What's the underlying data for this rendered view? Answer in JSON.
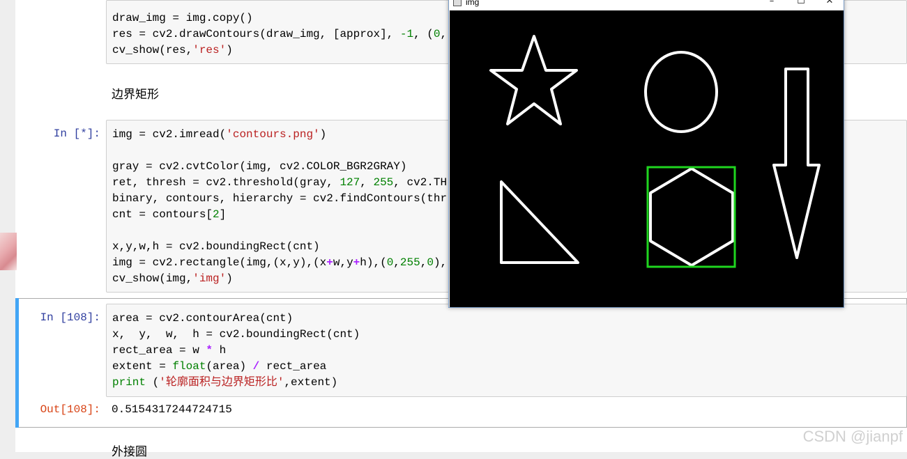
{
  "cells": {
    "top_code": {
      "lines": [
        "draw_img = img.copy()",
        "res = cv2.drawContours(draw_img, [approx], -1, (0,",
        "cv_show(res,'res')"
      ]
    },
    "markdown_heading": "边界矩形",
    "cell_bounding": {
      "prompt": "In [*]:",
      "line1": "img = cv2.imread(",
      "line1_str": "'contours.png'",
      "line1_end": ")",
      "line3": "gray = cv2.cvtColor(img, cv2.COLOR_BGR2GRAY)",
      "line4_a": "ret, thresh = cv2.threshold(gray, ",
      "line4_n1": "127",
      "line4_b": ", ",
      "line4_n2": "255",
      "line4_c": ", cv2.TH",
      "line5": "binary, contours, hierarchy = cv2.findContours(thr",
      "line6_a": "cnt = contours[",
      "line6_n": "2",
      "line6_b": "]",
      "line8": "x,y,w,h = cv2.boundingRect(cnt)",
      "line9_a": "img = cv2.rectangle(img,(x,y),(x",
      "line9_op1": "+",
      "line9_b": "w,y",
      "line9_op2": "+",
      "line9_c": "h),(",
      "line9_n1": "0",
      "line9_d": ",",
      "line9_n2": "255",
      "line9_e": ",",
      "line9_n3": "0",
      "line9_f": "),",
      "line10_a": "cv_show(img,",
      "line10_str": "'img'",
      "line10_b": ")"
    },
    "cell_extent": {
      "prompt": "In [108]:",
      "line1": "area = cv2.contourArea(cnt)",
      "line2": "x,  y,  w,  h = cv2.boundingRect(cnt)",
      "line3_a": "rect_area = w ",
      "line3_op": "*",
      "line3_b": " h",
      "line4_a": "extent = ",
      "line4_kw": "float",
      "line4_b": "(area) ",
      "line4_op": "/",
      "line4_c": " rect_area",
      "line5_kw": "print",
      "line5_a": " (",
      "line5_str": "'轮廓面积与边界矩形比'",
      "line5_b": ",extent)",
      "out_prompt": "Out[108]:",
      "output": "0.5154317244724715"
    },
    "next_markdown": "外接圆"
  },
  "image_window": {
    "title": "img",
    "minimize_glyph": "–",
    "maximize_glyph": "☐",
    "close_glyph": "✕"
  },
  "watermark": "CSDN @jianpf",
  "colors": {
    "accent_selected": "#42a5f5",
    "shape_stroke": "#ffffff",
    "bounding_rect": "#1fd51f",
    "canvas_bg": "#000000"
  }
}
